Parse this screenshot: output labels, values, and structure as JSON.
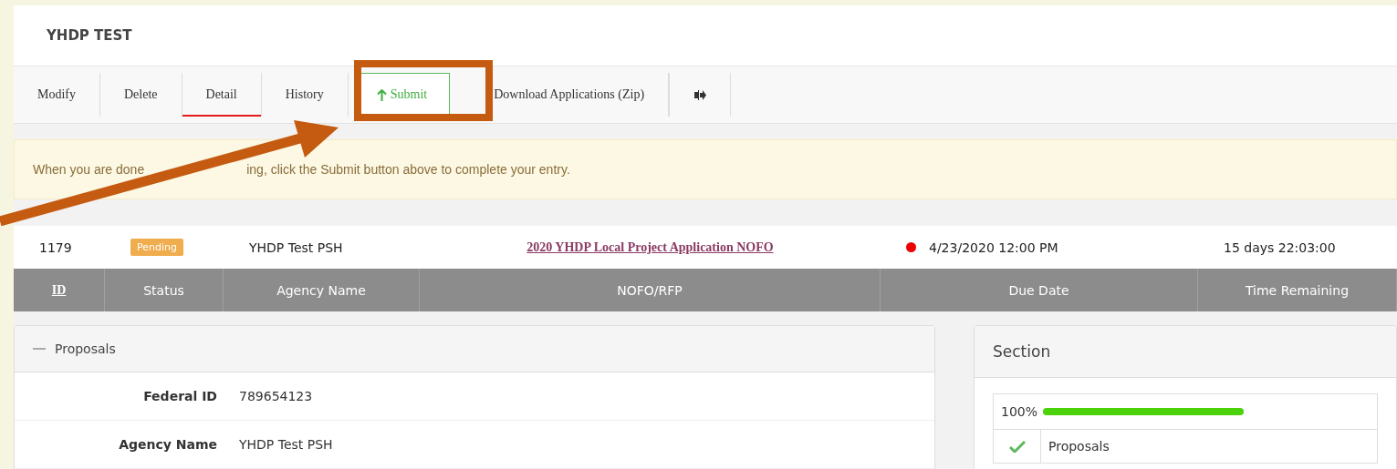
{
  "title": "YHDP TEST",
  "toolbar": [
    {
      "label": "Modify",
      "kind": "tab",
      "selected": false
    },
    {
      "label": "Delete",
      "kind": "tab",
      "selected": false
    },
    {
      "label": "Detail",
      "kind": "tab",
      "selected": true
    },
    {
      "label": "History",
      "kind": "tab",
      "selected": false
    },
    {
      "label": "Submit",
      "kind": "submit",
      "selected": false
    },
    {
      "label": "Download Applications (Zip)",
      "kind": "tab",
      "selected": false
    },
    {
      "kind": "exit"
    }
  ],
  "alert": [
    "When you are done",
    "ing, click the Submit button above to complete your entry."
  ],
  "record": {
    "id": "1179",
    "status": "Pending",
    "agency": "YHDP Test PSH",
    "nofo": "2020 YHDP Local Project Application NOFO",
    "due": "4/23/2020 12:00 PM",
    "remaining": "15 days 22:03:00"
  },
  "columns": [
    "ID",
    "Status",
    "Agency Name",
    "NOFO/RFP",
    "Due Date",
    "Time Remaining"
  ],
  "proposals": {
    "title": "Proposals",
    "expanded": true,
    "fields": [
      {
        "label": "Federal ID",
        "value": "789654123"
      },
      {
        "label": "Agency Name",
        "value": "YHDP Test PSH"
      }
    ]
  },
  "section": {
    "title": "Section",
    "progress": "100%",
    "level": 1,
    "items": [
      {
        "label": "Proposals",
        "checked": true
      }
    ]
  }
}
